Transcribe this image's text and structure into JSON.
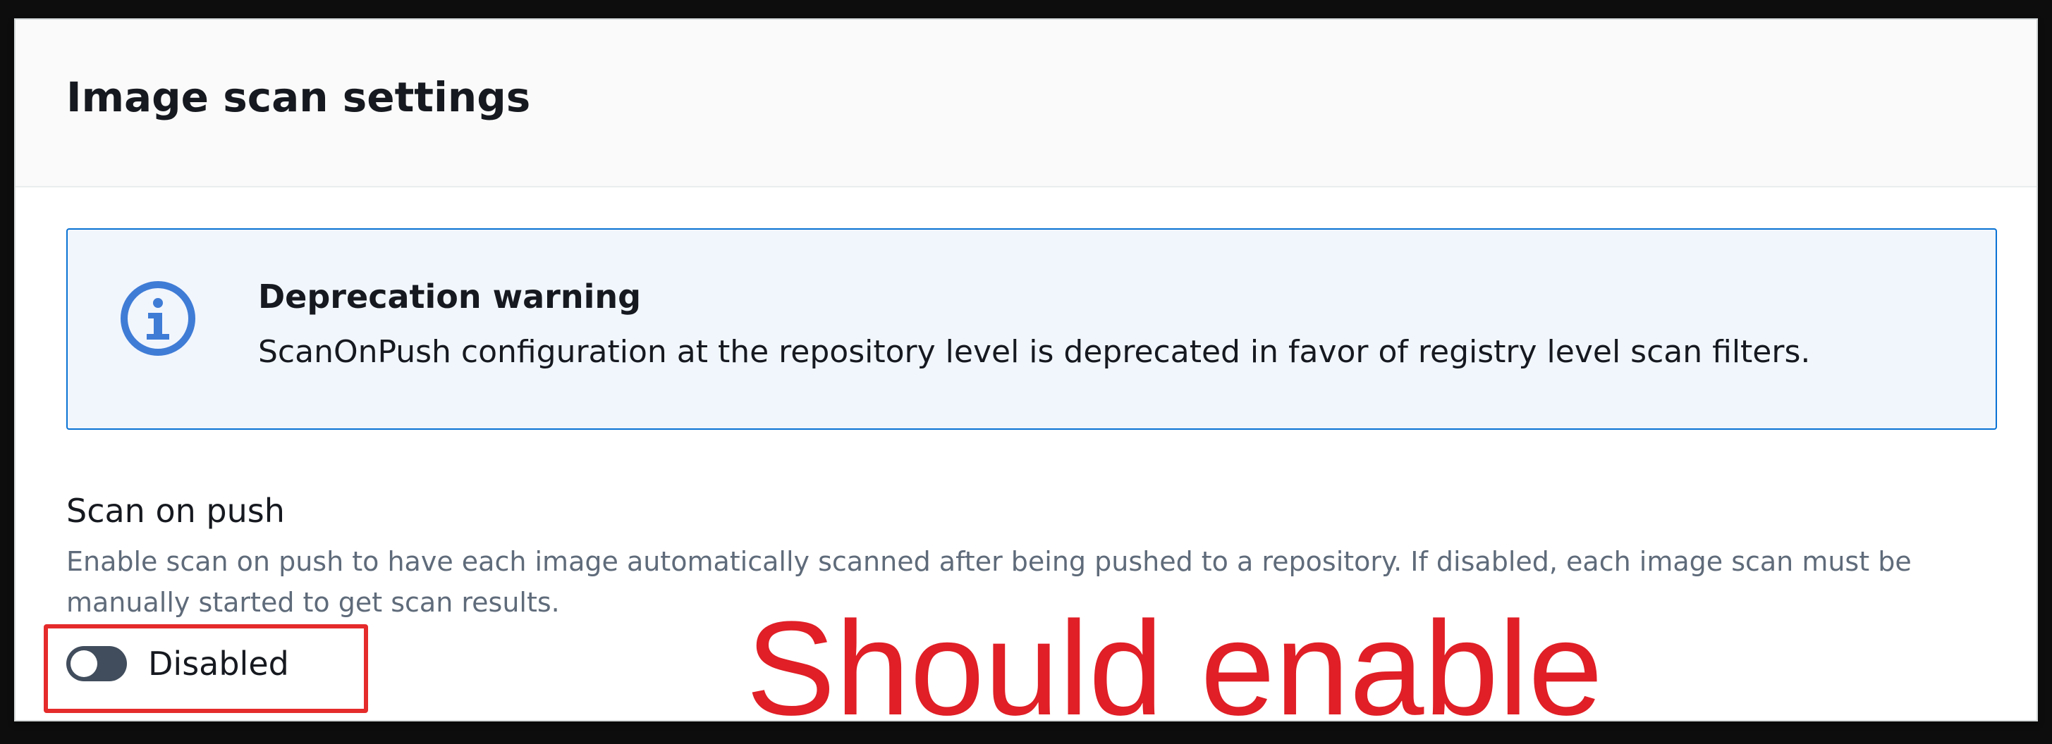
{
  "panel": {
    "title": "Image scan settings"
  },
  "alert": {
    "icon": "info-icon",
    "title": "Deprecation warning",
    "text": "ScanOnPush configuration at the repository level is deprecated in favor of registry level scan filters.",
    "accent_color": "#0972d3",
    "background_color": "#f1f6fd"
  },
  "scan_on_push": {
    "label": "Scan on push",
    "description": "Enable scan on push to have each image automatically scanned after being pushed to a repository. If disabled, each image scan must be manually started to get scan results.",
    "toggle_state": "off",
    "toggle_label": "Disabled"
  },
  "annotation": {
    "text": "Should enable",
    "color": "#e01f26"
  }
}
